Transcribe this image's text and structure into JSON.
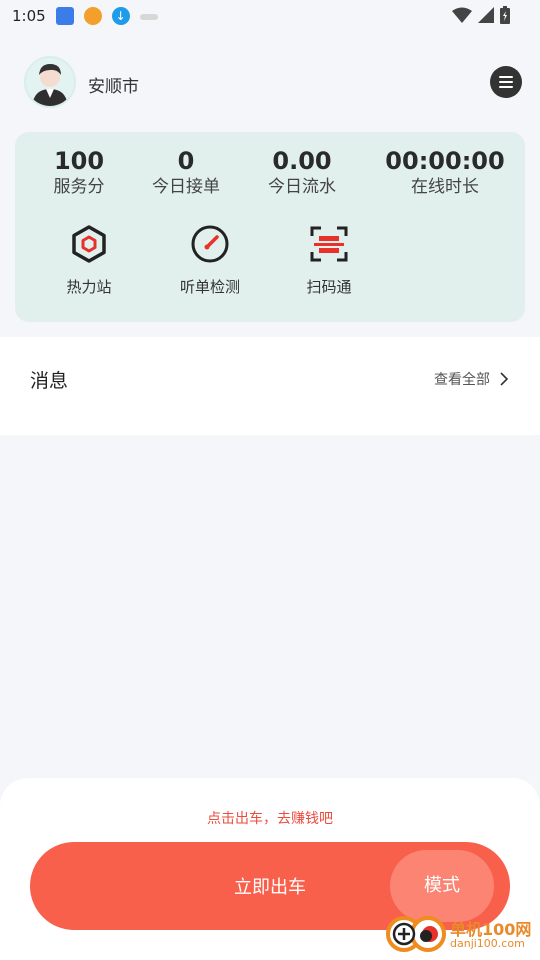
{
  "status_bar": {
    "time": "1:05"
  },
  "header": {
    "city": "安顺市"
  },
  "stats": [
    {
      "value": "100",
      "label": "服务分"
    },
    {
      "value": "0",
      "label": "今日接单"
    },
    {
      "value": "0.00",
      "label": "今日流水"
    },
    {
      "value": "00:00:00",
      "label": "在线时长"
    }
  ],
  "tools": [
    {
      "label": "热力站",
      "icon": "hexagon-icon"
    },
    {
      "label": "听单检测",
      "icon": "gauge-icon"
    },
    {
      "label": "扫码通",
      "icon": "scan-icon"
    }
  ],
  "messages": {
    "title": "消息",
    "view_all": "查看全部"
  },
  "bottom": {
    "hint": "点击出车，去赚钱吧",
    "go_label": "立即出车",
    "mode_label": "模式"
  },
  "watermark": {
    "name": "单机100网",
    "url": "danji100.com"
  },
  "colors": {
    "accent": "#f8604c",
    "accent_light": "#fb8473",
    "card_bg": "#e1efed",
    "hint": "#ee4b3e"
  }
}
